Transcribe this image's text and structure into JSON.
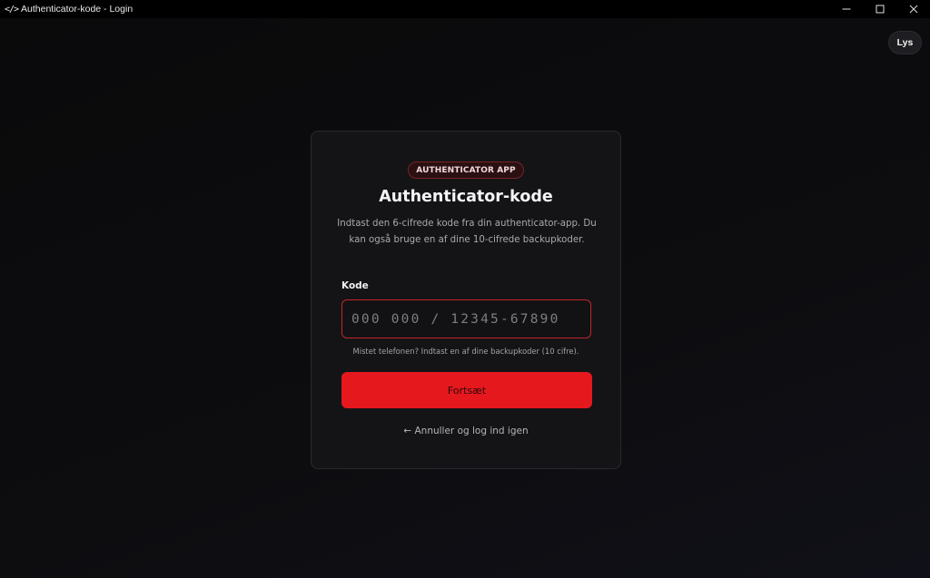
{
  "window": {
    "icon": "</>",
    "title": "Authenticator-kode - Login",
    "controls": [
      "minimize-icon",
      "maximize-icon",
      "close-icon"
    ]
  },
  "header": {
    "theme_toggle_label": "Lys"
  },
  "card": {
    "badge": "AUTHENTICATOR APP",
    "title": "Authenticator-kode",
    "description": "Indtast den 6-cifrede kode fra din authenticator-app. Du kan også bruge en af dine 10-cifrede backupkoder.",
    "field_label": "Kode",
    "code_input": {
      "value": "",
      "placeholder": "000 000 / 12345-67890"
    },
    "hint": "Mistet telefonen? Indtast en af dine backupkoder (10 cifre).",
    "submit_label": "Fortsæt",
    "cancel_label": "← Annuller og log ind igen"
  },
  "colors": {
    "accent": "#e5181e",
    "input_border": "#c0262c",
    "card_bg": "#141416",
    "page_bg": "#0b0b0d"
  }
}
